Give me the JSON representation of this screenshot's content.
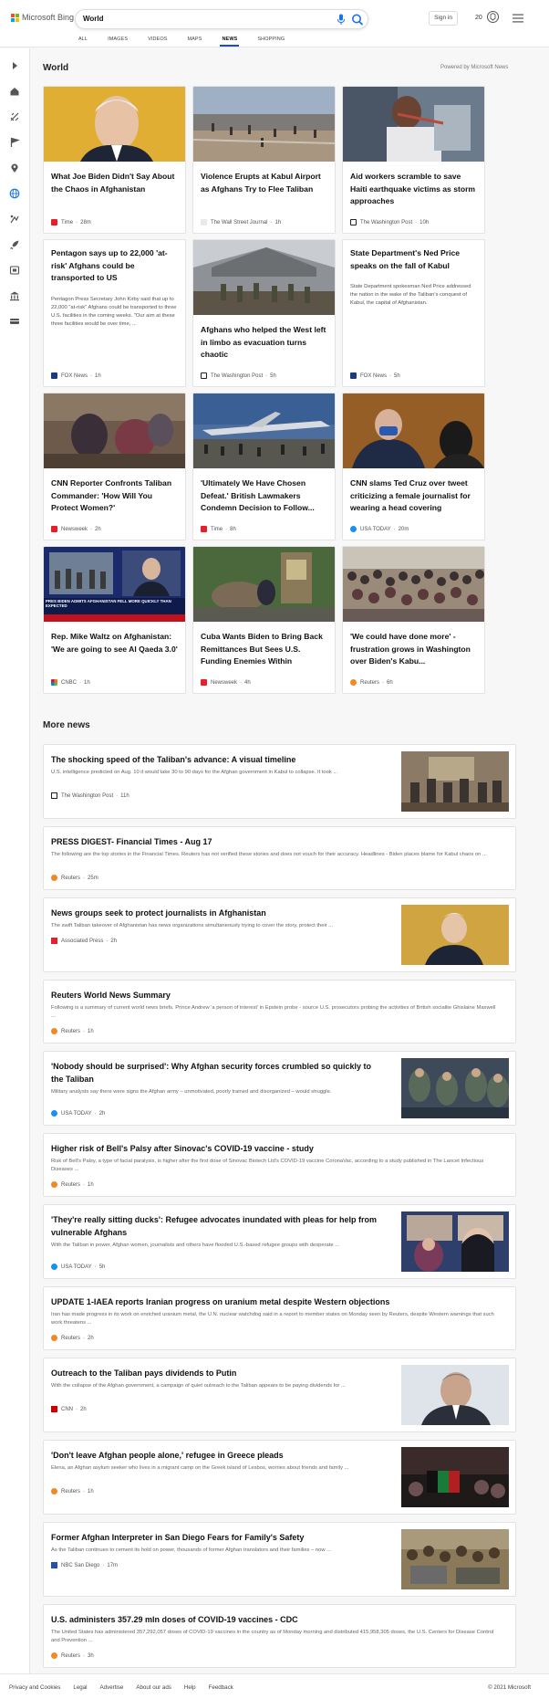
{
  "header": {
    "logo_text": "Microsoft Bing",
    "search_value": "World",
    "signin_label": "Sign in",
    "reward_count": "20",
    "tabs": [
      "ALL",
      "IMAGES",
      "VIDEOS",
      "MAPS",
      "NEWS",
      "SHOPPING"
    ],
    "active_tab": "NEWS"
  },
  "rail": {
    "icons": [
      "expand-arrow-icon",
      "home-icon",
      "sports-icon",
      "flag-icon",
      "location-pin-icon",
      "globe-icon",
      "business-icon",
      "rocket-icon",
      "entertainment-icon",
      "bank-icon",
      "car-icon"
    ]
  },
  "world": {
    "title": "World",
    "powered_by": "Powered by Microsoft News",
    "cards": [
      {
        "title": "What Joe Biden Didn't Say About the Chaos in Afghanistan",
        "desc": "",
        "source": "Time",
        "time": "28m",
        "source_color": "#e4202c"
      },
      {
        "title": "Violence Erupts at Kabul Airport as Afghans Try to Flee Taliban",
        "desc": "",
        "source": "The Wall Street Journal",
        "time": "1h",
        "source_color": "#555555"
      },
      {
        "title": "Aid workers scramble to save Haiti earthquake victims as storm approaches",
        "desc": "",
        "source": "The Washington Post",
        "time": "10h",
        "source_color": "#222222"
      },
      {
        "title": "Pentagon says up to 22,000 'at-risk' Afghans could be transported to US",
        "desc": "Pentagon Press Secretary John Kirby said that up to 22,000 \"at-risk\" Afghans could be transported to three U.S. facilities in the coming weeks. \"Our aim at these three facilities would be over time, ...",
        "source": "FOX News",
        "time": "1h",
        "source_color": "#1a3c7a"
      },
      {
        "title": "Afghans who helped the West left in limbo as evacuation turns chaotic",
        "desc": "",
        "source": "The Washington Post",
        "time": "5h",
        "source_color": "#222222"
      },
      {
        "title": "State Department's Ned Price speaks on the fall of Kabul",
        "desc": "State Department spokesman Ned Price addressed the nation in the wake of the Taliban's conquest of Kabul, the capital of Afghanistan.",
        "source": "FOX News",
        "time": "5h",
        "source_color": "#1a3c7a"
      },
      {
        "title": "CNN Reporter Confronts Taliban Commander: 'How Will You Protect Women?'",
        "desc": "",
        "source": "Newsweek",
        "time": "2h",
        "source_color": "#e4202c"
      },
      {
        "title": "'Ultimately We Have Chosen Defeat.' British Lawmakers Condemn Decision to Follow...",
        "desc": "",
        "source": "Time",
        "time": "8h",
        "source_color": "#e4202c"
      },
      {
        "title": "CNN slams Ted Cruz over tweet criticizing a female journalist for wearing a head covering",
        "desc": "",
        "source": "USA TODAY",
        "time": "20m",
        "source_color": "#1e90e8"
      },
      {
        "title": "Rep. Mike Waltz on Afghanistan: 'We are going to see Al Qaeda 3.0'",
        "desc": "",
        "source": "CNBC",
        "time": "1h",
        "source_color": "#f37021",
        "banner": "PRES BIDEN ADMITS AFGHANISTAN FELL MORE QUICKLY THAN EXPECTED"
      },
      {
        "title": "Cuba Wants Biden to Bring Back Remittances But Sees U.S. Funding Enemies Within",
        "desc": "",
        "source": "Newsweek",
        "time": "4h",
        "source_color": "#e4202c"
      },
      {
        "title": "'We could have done more' - frustration grows in Washington over Biden's Kabu...",
        "desc": "",
        "source": "Reuters",
        "time": "6h",
        "source_color": "#f08a24"
      }
    ]
  },
  "more_news": {
    "title": "More news",
    "items": [
      {
        "title": "The shocking speed of the Taliban's advance: A visual timeline",
        "desc": "U.S. intelligence predicted on Aug. 10 it would take 30 to 90 days for the Afghan government in Kabul to collapse. It took ...",
        "source": "The Washington Post",
        "time": "11h",
        "source_color": "#222222"
      },
      {
        "title": "PRESS DIGEST- Financial Times - Aug 17",
        "desc": "The following are the top stories in the Financial Times. Reuters has not verified these stories and does not vouch for their accuracy. Headlines - Biden places blame for Kabul chaos on ...",
        "source": "Reuters",
        "time": "25m",
        "source_color": "#f08a24"
      },
      {
        "title": "News groups seek to protect journalists in Afghanistan",
        "desc": "The swift Taliban takeover of Afghanistan has news organizations simultaneously trying to cover the story, protect their ...",
        "source": "Associated Press",
        "time": "2h",
        "source_color": "#e4202c"
      },
      {
        "title": "Reuters World News Summary",
        "desc": "Following is a summary of current world news briefs. Prince Andrew 'a person of interest' in Epstein probe - source U.S. prosecutors probing the activities of British socialite Ghislaine Maxwell ...",
        "source": "Reuters",
        "time": "1h",
        "source_color": "#f08a24"
      },
      {
        "title": "'Nobody should be surprised': Why Afghan security forces crumbled so quickly to the Taliban",
        "desc": "Military analysts say there were signs the Afghan army – unmotivated, poorly trained and disorganized – would struggle.",
        "source": "USA TODAY",
        "time": "2h",
        "source_color": "#1e90e8"
      },
      {
        "title": "Higher risk of Bell's Palsy after Sinovac's COVID-19 vaccine - study",
        "desc": "Risk of Bell's Palsy, a type of facial paralysis, is higher after the first dose of Sinovac Biotech Ltd's COVID-19 vaccine CoronaVac, according to a study published in The Lancet Infectious Diseases ...",
        "source": "Reuters",
        "time": "1h",
        "source_color": "#f08a24"
      },
      {
        "title": "'They're really sitting ducks': Refugee advocates inundated with pleas for help from vulnerable Afghans",
        "desc": "With the Taliban in power, Afghan women, journalists and others have flooded U.S.-based refugee groups with desperate ...",
        "source": "USA TODAY",
        "time": "5h",
        "source_color": "#1e90e8"
      },
      {
        "title": "UPDATE 1-IAEA reports Iranian progress on uranium metal despite Western objections",
        "desc": "Iran has made progress in its work on enriched uranium metal, the U.N. nuclear watchdog said in a report to member states on Monday seen by Reuters, despite Western warnings that such work threatens ...",
        "source": "Reuters",
        "time": "2h",
        "source_color": "#f08a24"
      },
      {
        "title": "Outreach to the Taliban pays dividends to Putin",
        "desc": "With the collapse of the Afghan government, a campaign of quiet outreach to the Taliban appears to be paying dividends for ...",
        "source": "CNN",
        "time": "2h",
        "source_color": "#cc0000"
      },
      {
        "title": "'Don't leave Afghan people alone,' refugee in Greece pleads",
        "desc": "Elena, an Afghan asylum seeker who lives in a migrant camp on the Greek island of Lesbos, worries about friends and family ...",
        "source": "Reuters",
        "time": "1h",
        "source_color": "#f08a24"
      },
      {
        "title": "Former Afghan Interpreter in San Diego Fears for Family's Safety",
        "desc": "As the Taliban continues to cement its hold on power, thousands of former Afghan translators and their families – now ...",
        "source": "NBC San Diego",
        "time": "17m",
        "source_color": "#2a4fa8"
      },
      {
        "title": "U.S. administers 357.29 mln doses of COVID-19 vaccines - CDC",
        "desc": "The United States has administered 357,292,057 doses of COVID-19 vaccines in the country as of Monday morning and distributed 415,958,305 doses, the U.S. Centers for Disease Control and Prevention ...",
        "source": "Reuters",
        "time": "3h",
        "source_color": "#f08a24"
      }
    ]
  },
  "footer": {
    "links": [
      "Privacy and Cookies",
      "Legal",
      "Advertise",
      "About our ads",
      "Help",
      "Feedback"
    ],
    "copyright": "© 2021 Microsoft"
  },
  "colors": {
    "accent": "#174ae4",
    "link_blue": "#1a73e8"
  }
}
